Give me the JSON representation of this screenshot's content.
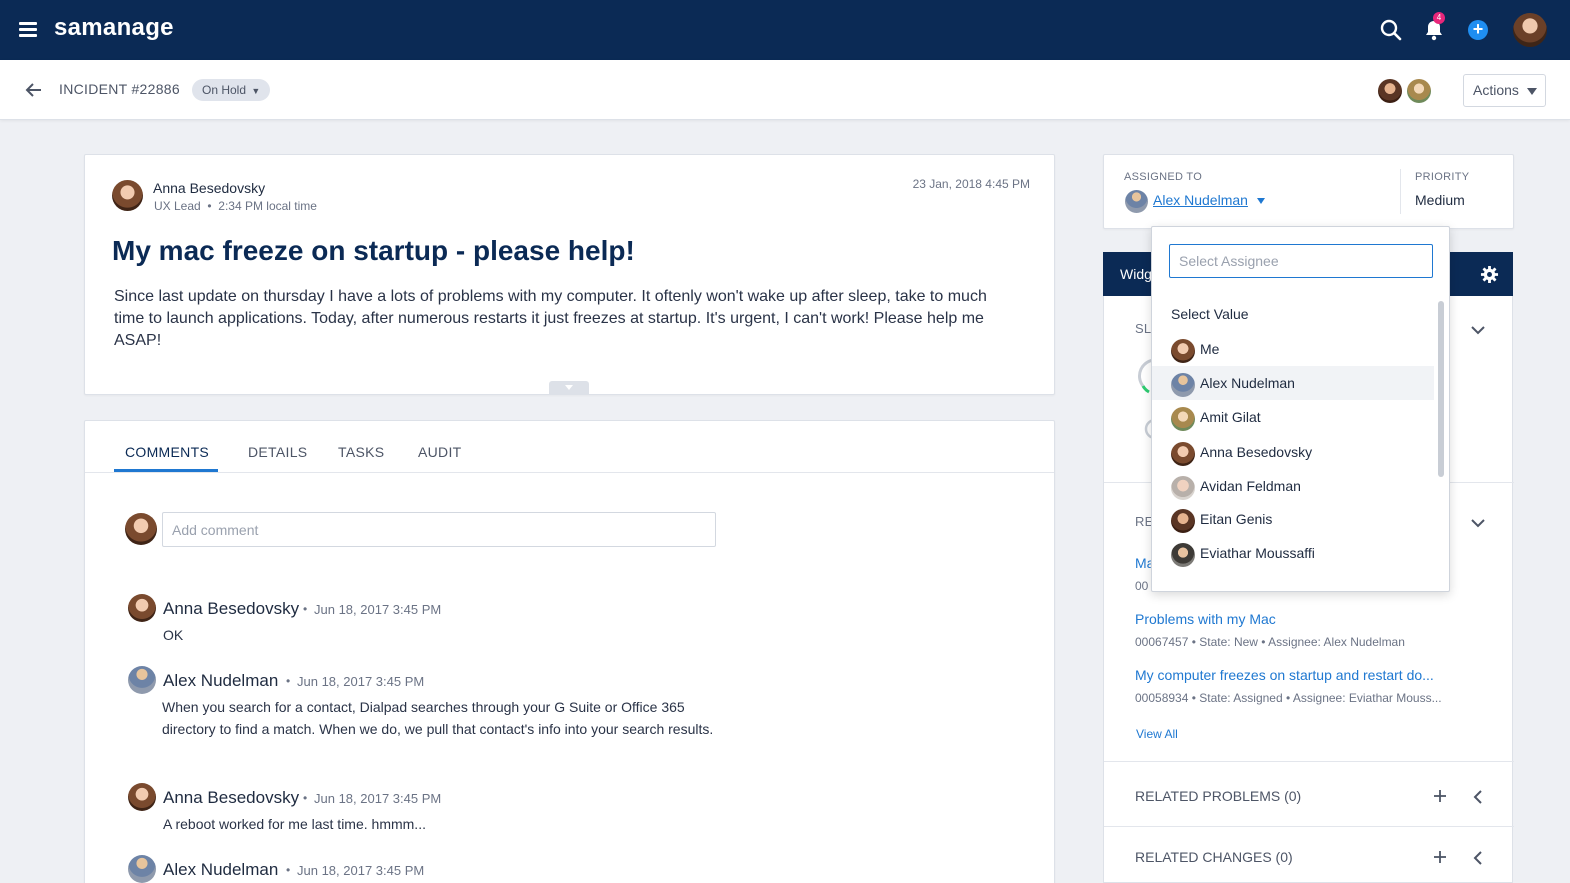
{
  "app": {
    "logo": "samanage",
    "notifications_count": "4"
  },
  "header": {
    "incident_id": "INCIDENT #22886",
    "status": "On Hold",
    "actions_label": "Actions"
  },
  "ticket": {
    "author": {
      "name": "Anna Besedovsky",
      "role": "UX Lead",
      "local_time": "2:34 PM local time"
    },
    "date": "23 Jan, 2018 4:45 PM",
    "title": "My mac freeze on startup - please help!",
    "description": "Since last update on thursday I have a lots of problems with my computer. It oftenly won't wake up after sleep, take to much time to launch applications. Today, after numerous restarts it just freezes at startup. It's urgent, I can't work! Please help me ASAP!"
  },
  "tabs": [
    {
      "label": "COMMENTS",
      "active": true
    },
    {
      "label": "DETAILS"
    },
    {
      "label": "TASKS"
    },
    {
      "label": "AUDIT"
    }
  ],
  "comment_input": {
    "placeholder": "Add comment"
  },
  "comments": [
    {
      "author": "Anna Besedovsky",
      "date": "Jun 18, 2017 3:45 PM",
      "text": "OK"
    },
    {
      "author": "Alex Nudelman",
      "date": "Jun 18, 2017 3:45 PM",
      "text": "When you search for a contact, Dialpad searches through your G Suite or Office 365 directory to find a match. When we do, we pull that contact's info into your search results."
    },
    {
      "author": "Anna Besedovsky",
      "date": "Jun 18, 2017 3:45 PM",
      "text": "A reboot worked for me last time. hmmm..."
    },
    {
      "author": "Alex Nudelman",
      "date": "Jun 18, 2017 3:45 PM",
      "text": ""
    }
  ],
  "assignment": {
    "assigned_to_label": "ASSIGNED TO",
    "assignee": "Alex Nudelman",
    "priority_label": "PRIORITY",
    "priority": "Medium"
  },
  "widgets": {
    "title_visible": "Widg",
    "sla_label_visible": "SL",
    "related_label_visible": "RE",
    "partial_link": "Ma",
    "partial_meta": "00"
  },
  "related_incidents": [
    {
      "title": "Problems with my Mac",
      "meta": "00067457  •  State: New  •  Assignee: Alex Nudelman"
    },
    {
      "title": "My computer freezes on startup and restart do...",
      "meta": "00058934  •  State: Assigned  •  Assignee: Eviathar Mouss..."
    }
  ],
  "view_all": "View All",
  "related_problems": "RELATED PROBLEMS (0)",
  "related_changes": "RELATED CHANGES (0)",
  "assignee_dropdown": {
    "placeholder": "Select Assignee",
    "header": "Select Value",
    "options": [
      {
        "name": "Me"
      },
      {
        "name": "Alex Nudelman",
        "highlighted": true
      },
      {
        "name": "Amit Gilat"
      },
      {
        "name": "Anna Besedovsky"
      },
      {
        "name": "Avidan Feldman"
      },
      {
        "name": "Eitan Genis"
      },
      {
        "name": "Eviathar Moussaffi"
      }
    ]
  },
  "colors": {
    "navy": "#0b2a55",
    "accent_blue": "#1f78d1",
    "badge_pink": "#e8267a"
  },
  "icons": [
    "menu-icon",
    "search-icon",
    "bell-icon",
    "plus-icon",
    "back-arrow-icon",
    "gear-icon",
    "chevron-down-icon",
    "chevron-left-icon"
  ]
}
